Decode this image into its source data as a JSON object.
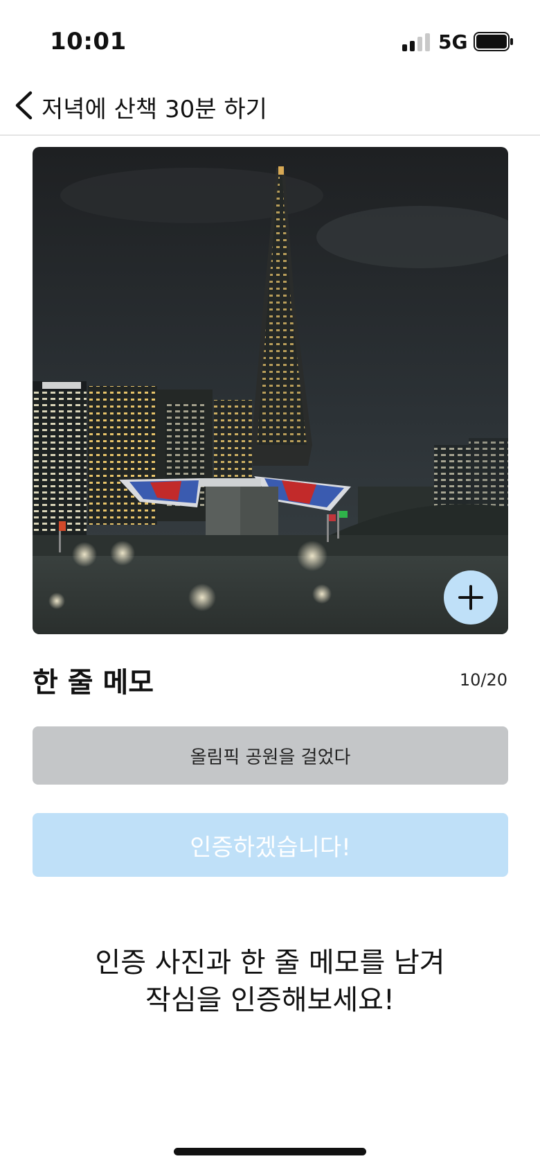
{
  "status_bar": {
    "time": "10:01",
    "network": "5G",
    "signal_bars_active": 2,
    "signal_bars_total": 4,
    "battery_level": 1.0
  },
  "nav": {
    "back_icon": "chevron-left-icon",
    "title": "저녁에 산책 30분 하기"
  },
  "photo": {
    "add_icon": "plus-icon",
    "add_button_color": "#bfe0f8"
  },
  "memo": {
    "heading": "한 줄 메모",
    "counter": "10/20",
    "value": "올림픽 공원을 걸었다"
  },
  "submit": {
    "label": "인증하겠습니다!",
    "color": "#bfe0f8"
  },
  "guide": {
    "line1": "인증 사진과 한 줄 메모를 남겨",
    "line2": "작심을 인증해보세요!"
  }
}
